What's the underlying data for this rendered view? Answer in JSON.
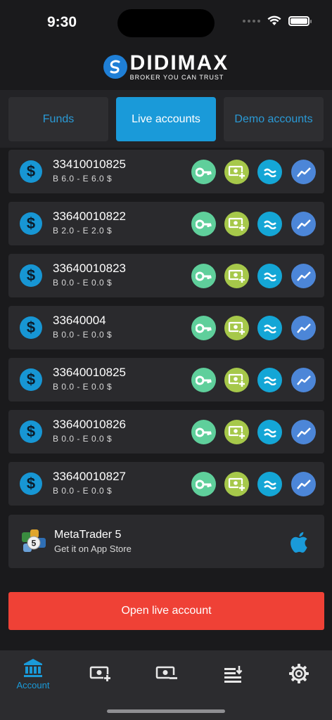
{
  "status": {
    "time": "9:30"
  },
  "brand": {
    "name": "DIDIMAX",
    "tagline": "BROKER YOU CAN TRUST"
  },
  "tabs": [
    {
      "label": "Funds",
      "active": false
    },
    {
      "label": "Live accounts",
      "active": true
    },
    {
      "label": "Demo accounts",
      "active": false
    }
  ],
  "accounts": [
    {
      "number": "33410010825",
      "balance": "B 6.0  - E 6.0 $"
    },
    {
      "number": "33640010822",
      "balance": "B 2.0  - E 2.0 $"
    },
    {
      "number": "33640010823",
      "balance": "B 0.0  - E 0.0 $"
    },
    {
      "number": "33640004",
      "balance": "B 0.0  - E 0.0 $"
    },
    {
      "number": "33640010825",
      "balance": "B 0.0  - E 0.0 $"
    },
    {
      "number": "33640010826",
      "balance": "B 0.0  - E 0.0 $"
    },
    {
      "number": "33640010827",
      "balance": "B 0.0  - E 0.0 $"
    }
  ],
  "account_actions": [
    "key-icon",
    "deposit-icon",
    "wave-icon",
    "chart-icon"
  ],
  "colors": {
    "key": "#5fcf9b",
    "deposit": "#a6c84a",
    "wave": "#14a6d6",
    "chart": "#4c86d8",
    "accent": "#1a9ad9",
    "danger": "#ef4136"
  },
  "metatrader": {
    "title": "MetaTrader 5",
    "subtitle": "Get it on App Store",
    "badge": "5"
  },
  "cta": {
    "label": "Open live account"
  },
  "nav": [
    {
      "label": "Account",
      "icon": "bank-icon"
    },
    {
      "label": "",
      "icon": "deposit-icon"
    },
    {
      "label": "",
      "icon": "withdraw-icon"
    },
    {
      "label": "",
      "icon": "transfer-icon"
    },
    {
      "label": "",
      "icon": "gear-icon"
    }
  ]
}
